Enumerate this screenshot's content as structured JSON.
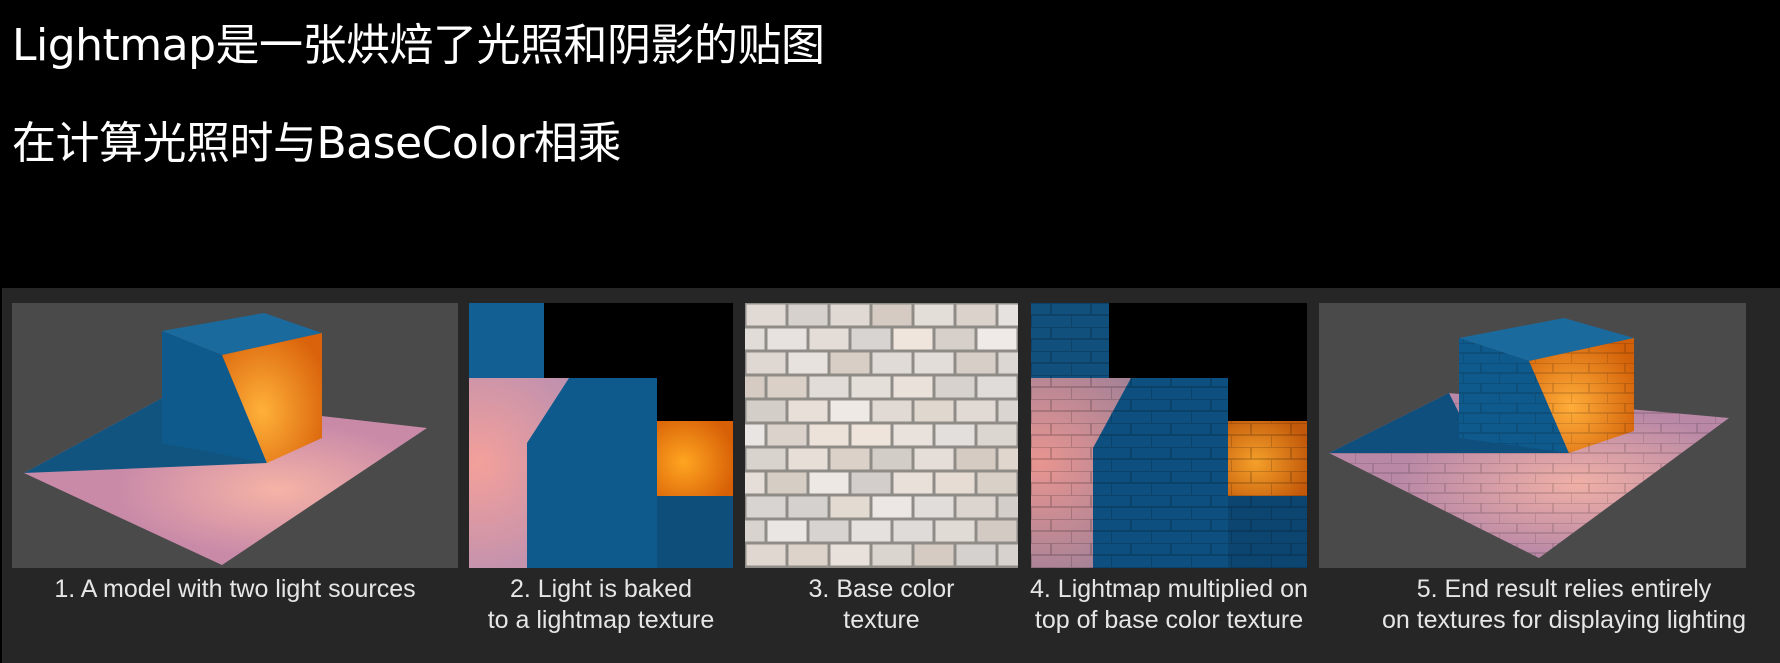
{
  "headings": {
    "line1": "Lightmap是一张烘焙了光照和阴影的贴图",
    "line2": "在计算光照时与BaseColor相乘"
  },
  "figure": {
    "panels": [
      {
        "caption": "1. A model with two light sources"
      },
      {
        "caption": "2. Light is baked\nto a lightmap texture"
      },
      {
        "caption": "3. Base color\ntexture"
      },
      {
        "caption": "4. Lightmap multiplied on\ntop of base color texture"
      },
      {
        "caption": "5. End result relies entirely\non textures for displaying lighting"
      }
    ],
    "colors": {
      "background": "#000000",
      "strip": "#262626",
      "panel_gray": "#4a4a4a",
      "cube_blue": "#0f5a8c",
      "cube_orange": "#f07c0a",
      "floor_pink": "#c98aa8",
      "brick": "#d9d4cc"
    }
  }
}
